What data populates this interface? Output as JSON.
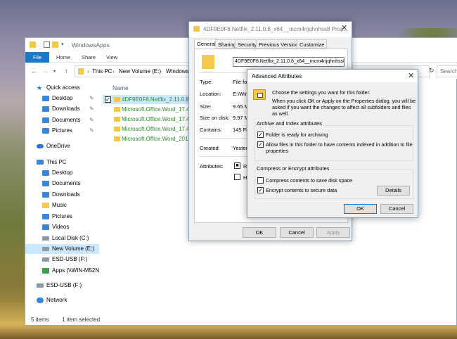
{
  "explorer": {
    "title": "WindowsApps",
    "ribbon_tabs": [
      "File",
      "Home",
      "Share",
      "View"
    ],
    "breadcrumbs": [
      "This PC",
      "New Volume (E:)",
      "WindowsA"
    ],
    "search_placeholder": "Search",
    "column_name": "Name",
    "nav": [
      {
        "label": "Quick access",
        "icon": "star-icon"
      },
      {
        "label": "Desktop",
        "icon": "desktop-icon",
        "pinned": true
      },
      {
        "label": "Downloads",
        "icon": "downloads-icon",
        "pinned": true
      },
      {
        "label": "Documents",
        "icon": "documents-icon",
        "pinned": true
      },
      {
        "label": "Pictures",
        "icon": "pictures-icon",
        "pinned": true
      },
      {
        "label": "OneDrive",
        "icon": "onedrive-icon"
      },
      {
        "label": "This PC",
        "icon": "this-pc-icon"
      },
      {
        "label": "Desktop",
        "icon": "desktop-icon"
      },
      {
        "label": "Documents",
        "icon": "documents-icon"
      },
      {
        "label": "Downloads",
        "icon": "downloads-icon"
      },
      {
        "label": "Music",
        "icon": "music-icon"
      },
      {
        "label": "Pictures",
        "icon": "pictures-icon"
      },
      {
        "label": "Videos",
        "icon": "videos-icon"
      },
      {
        "label": "Local Disk (C:)",
        "icon": "drive-icon"
      },
      {
        "label": "New Volume (E:)",
        "icon": "drive-icon",
        "selected": true
      },
      {
        "label": "ESD-USB (F:)",
        "icon": "usb-drive-icon"
      },
      {
        "label": "Apps (\\\\WIN-M52N",
        "icon": "network-drive-icon"
      },
      {
        "label": "ESD-USB (F:)",
        "icon": "usb-drive-icon"
      },
      {
        "label": "Network",
        "icon": "network-icon"
      }
    ],
    "files": [
      {
        "name": "4DF9E0F8.Netflix_2.11.0.8_x6",
        "selected": true
      },
      {
        "name": "Microsoft.Office.Word_17.40"
      },
      {
        "name": "Microsoft.Office.Word_17.40"
      },
      {
        "name": "Microsoft.Office.Word_17.40"
      },
      {
        "name": "Microsoft.Office.Word_2015.4"
      }
    ],
    "status": {
      "items": "5 items",
      "selected": "1 item selected"
    }
  },
  "properties": {
    "title": "4DF9E0F8.Netflix_2.11.0.8_x64__mcm4njqhnhss8 Prop...",
    "tabs": [
      "General",
      "Sharing",
      "Security",
      "Previous Versions",
      "Customize"
    ],
    "name_value": "4DF9E0F8.Netflix_2.11.0.8_x64__mcm4njqhnhss8",
    "type_label": "Type:",
    "type_value": "File fo",
    "location_label": "Location:",
    "location_value": "E:\\Win",
    "size_label": "Size:",
    "size_value": "9.65 M",
    "size_on_disk_label": "Size on disk:",
    "size_on_disk_value": "9.97 M",
    "contains_label": "Contains:",
    "contains_value": "145 Fil",
    "created_label": "Created:",
    "created_value": "Yester",
    "attributes_label": "Attributes:",
    "attr_readonly": "Rea",
    "attr_hidden": "Hid",
    "ok": "OK",
    "cancel": "Cancel",
    "apply": "Apply"
  },
  "advanced": {
    "title": "Advanced Attributes",
    "intro_line1": "Choose the settings you want for this folder.",
    "intro_line2": "When you click OK or Apply on the Properties dialog, you will be asked if you want the changes to affect all subfolders and files as well.",
    "archive_group": "Archive and Index attributes",
    "archive_cb": "Folder is ready for archiving",
    "index_cb": "Allow files in this folder to have contents indexed in addition to file properties",
    "compress_group": "Compress or Encrypt attributes",
    "compress_cb": "Compress contents to save disk space",
    "encrypt_cb": "Encrypt contents to secure data",
    "details": "Details",
    "ok": "OK",
    "cancel": "Cancel"
  }
}
